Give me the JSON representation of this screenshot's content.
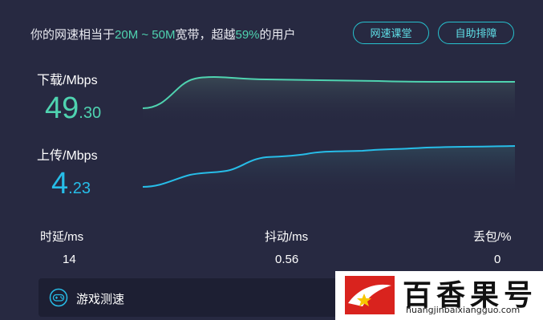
{
  "header": {
    "summary_prefix": "你的网速相当于",
    "summary_range": "20M ~ 50M",
    "summary_mid": "宽带，超越",
    "summary_percent": "59%",
    "summary_suffix": "的用户",
    "btn_course": "网速课堂",
    "btn_help": "自助排障"
  },
  "download": {
    "label": "下载/Mbps",
    "value_int": "49",
    "value_dec": ".30",
    "color": "#4fd3b0"
  },
  "upload": {
    "label": "上传/Mbps",
    "value_int": "4",
    "value_dec": ".23",
    "color": "#27bde8"
  },
  "stats": {
    "latency_label": "时延/ms",
    "latency_value": "14",
    "jitter_label": "抖动/ms",
    "jitter_value": "0.56",
    "loss_label": "丢包/%",
    "loss_value": "0"
  },
  "game": {
    "label": "游戏测速",
    "icon": "gamepad-icon"
  },
  "watermark": {
    "title": "百香果号",
    "url": "huangjinbaixiangguo.com"
  }
}
